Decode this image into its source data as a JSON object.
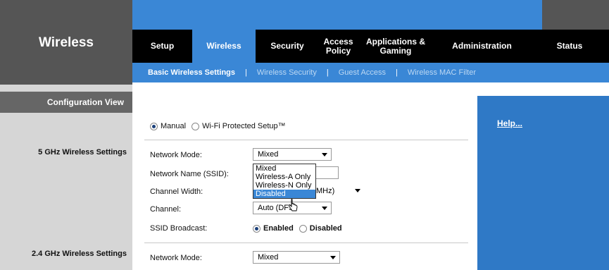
{
  "brand": "Wireless",
  "tabs": [
    {
      "label": "Setup"
    },
    {
      "label": "Wireless"
    },
    {
      "label": "Security"
    },
    {
      "label": "Access Policy"
    },
    {
      "label": "Applications & Gaming"
    },
    {
      "label": "Administration"
    },
    {
      "label": "Status"
    }
  ],
  "subnav": [
    {
      "label": "Basic Wireless Settings"
    },
    {
      "label": "Wireless Security"
    },
    {
      "label": "Guest Access"
    },
    {
      "label": "Wireless MAC Filter"
    }
  ],
  "sidebar": {
    "config_view": "Configuration View",
    "ghz5_label": "5 GHz Wireless Settings",
    "ghz24_label": "2.4 GHz Wireless Settings"
  },
  "setup_mode": {
    "manual": "Manual",
    "wps": "Wi-Fi Protected Setup™",
    "selected": "Manual"
  },
  "help_link": "Help...",
  "ghz5": {
    "network_mode_label": "Network Mode:",
    "network_mode_value": "Mixed",
    "ssid_label": "Network Name (SSID):",
    "channel_width_label": "Channel Width:",
    "channel_width_value": "MHz)",
    "channel_label": "Channel:",
    "channel_value": "Auto (DFS",
    "ssid_broadcast_label": "SSID Broadcast:",
    "ssid_broadcast_enabled": "Enabled",
    "ssid_broadcast_disabled": "Disabled",
    "dropdown_options": [
      "Mixed",
      "Wireless-A Only",
      "Wireless-N Only",
      "Disabled"
    ],
    "dropdown_highlighted": "Disabled"
  },
  "ghz24": {
    "network_mode_label": "Network Mode:",
    "network_mode_value": "Mixed"
  },
  "colors": {
    "accent": "#3a87d6",
    "help_bg": "#2f79c6",
    "dark": "#000000",
    "sidebar": "#d6d6d6"
  }
}
